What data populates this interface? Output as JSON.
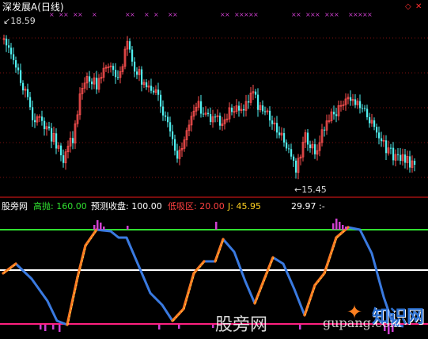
{
  "main_panel": {
    "title": "深发展A",
    "period": "(日线)",
    "high_label": "18.59",
    "low_label": "←15.45",
    "colors": {
      "up": "#ff5050",
      "down": "#50f0f0",
      "marker": "#d040d0"
    }
  },
  "indicator_panel": {
    "name": "股旁网",
    "items": [
      {
        "label": "高抛:",
        "value": "160.00",
        "color": "#30e030"
      },
      {
        "label": "预测收盘:",
        "value": "100.00",
        "color": "#ffffff"
      },
      {
        "label": "低吸区:",
        "value": "20.00",
        "color": "#ff4040"
      },
      {
        "label": "J:",
        "value": "45.95",
        "color": "#ffd020"
      },
      {
        "label": "",
        "value": "29.97",
        "color": "#ffffff"
      },
      {
        "label": "",
        "value": ":-",
        "color": "#ffffff"
      }
    ],
    "lines": [
      {
        "name": "high-sell",
        "value": 160,
        "color": "#30e030"
      },
      {
        "name": "forecast-close",
        "value": 100,
        "color": "#ffffff"
      },
      {
        "name": "low-buy",
        "value": 20,
        "color": "#ff2080"
      }
    ]
  },
  "watermarks": {
    "center": "股旁网",
    "url": "gupang.com",
    "logo": "知识网"
  },
  "chart_data": {
    "type": "candlestick-with-oscillator",
    "price_high": 18.59,
    "price_low": 15.45,
    "oscillator_levels": [
      160,
      100,
      20
    ]
  }
}
